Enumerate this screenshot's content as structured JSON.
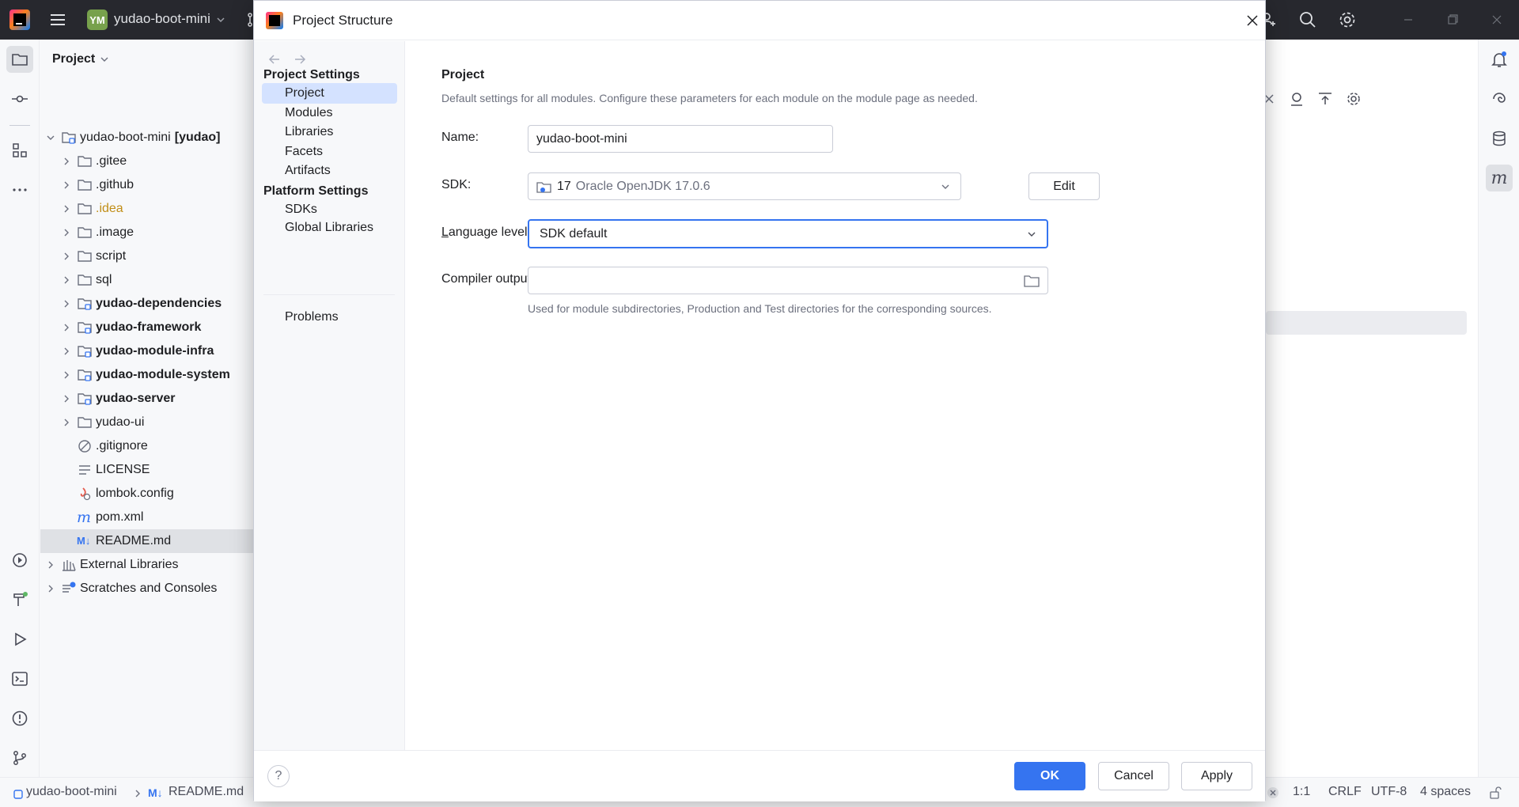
{
  "titlebar": {
    "project_badge": "YM",
    "project_name": "yudao-boot-mini"
  },
  "project_panel": {
    "header": "Project",
    "tree": [
      {
        "label": "yudao-boot-mini",
        "suffix": "[yudao]",
        "level": 0,
        "expandable": true,
        "expanded": true,
        "icon": "module-folder-icon",
        "bold": false
      },
      {
        "label": ".gitee",
        "level": 1,
        "expandable": true,
        "icon": "folder-icon",
        "bold": false
      },
      {
        "label": ".github",
        "level": 1,
        "expandable": true,
        "icon": "folder-icon",
        "bold": false
      },
      {
        "label": ".idea",
        "level": 1,
        "expandable": true,
        "icon": "folder-icon",
        "bold": false,
        "color": "#c18e17"
      },
      {
        "label": ".image",
        "level": 1,
        "expandable": true,
        "icon": "folder-icon",
        "bold": false
      },
      {
        "label": "script",
        "level": 1,
        "expandable": true,
        "icon": "folder-icon",
        "bold": false
      },
      {
        "label": "sql",
        "level": 1,
        "expandable": true,
        "icon": "folder-icon",
        "bold": false
      },
      {
        "label": "yudao-dependencies",
        "level": 1,
        "expandable": true,
        "icon": "module-folder-icon",
        "bold": true
      },
      {
        "label": "yudao-framework",
        "level": 1,
        "expandable": true,
        "icon": "module-folder-icon",
        "bold": true
      },
      {
        "label": "yudao-module-infra",
        "level": 1,
        "expandable": true,
        "icon": "module-folder-icon",
        "bold": true
      },
      {
        "label": "yudao-module-system",
        "level": 1,
        "expandable": true,
        "icon": "module-folder-icon",
        "bold": true
      },
      {
        "label": "yudao-server",
        "level": 1,
        "expandable": true,
        "icon": "module-folder-icon",
        "bold": true
      },
      {
        "label": "yudao-ui",
        "level": 1,
        "expandable": true,
        "icon": "folder-icon",
        "bold": false
      },
      {
        "label": ".gitignore",
        "level": 1,
        "expandable": false,
        "icon": "ignore-file-icon",
        "bold": false
      },
      {
        "label": "LICENSE",
        "level": 1,
        "expandable": false,
        "icon": "text-file-icon",
        "bold": false
      },
      {
        "label": "lombok.config",
        "level": 1,
        "expandable": false,
        "icon": "config-file-icon",
        "bold": false
      },
      {
        "label": "pom.xml",
        "level": 1,
        "expandable": false,
        "icon": "maven-icon",
        "bold": false
      },
      {
        "label": "README.md",
        "level": 1,
        "expandable": false,
        "icon": "markdown-icon",
        "bold": false,
        "selected": true
      },
      {
        "label": "External Libraries",
        "level": 0,
        "expandable": true,
        "icon": "libraries-icon",
        "bold": false
      },
      {
        "label": "Scratches and Consoles",
        "level": 0,
        "expandable": true,
        "icon": "scratches-icon",
        "bold": false
      }
    ]
  },
  "dialog": {
    "title": "Project Structure",
    "nav": {
      "groups": [
        {
          "label": "Project Settings",
          "items": [
            "Project",
            "Modules",
            "Libraries",
            "Facets",
            "Artifacts"
          ]
        },
        {
          "label": "Platform Settings",
          "items": [
            "SDKs",
            "Global Libraries"
          ]
        }
      ],
      "extra": "Problems",
      "selected": "Project"
    },
    "content": {
      "section_title": "Project",
      "section_desc": "Default settings for all modules. Configure these parameters for each module on the module page as needed.",
      "name_label": "Name:",
      "name_value": "yudao-boot-mini",
      "sdk_label": "SDK:",
      "sdk_version": "17",
      "sdk_name": "Oracle OpenJDK 17.0.6",
      "edit_label": "Edit",
      "language_label_prefix": "",
      "language_label_mnemonic": "L",
      "language_label_rest": "anguage level:",
      "language_value": "SDK default",
      "compiler_label": "Compiler output:",
      "compiler_value": "",
      "compiler_hint": "Used for module subdirectories, Production and Test directories for the corresponding sources."
    },
    "footer": {
      "help": "?",
      "ok": "OK",
      "cancel": "Cancel",
      "apply": "Apply"
    }
  },
  "statusbar": {
    "breadcrumb_project": "yudao-boot-mini",
    "breadcrumb_file": "README.md",
    "position": "1:1",
    "line_separator": "CRLF",
    "encoding": "UTF-8",
    "indent": "4 spaces"
  },
  "colors": {
    "accent": "#3574f0",
    "selection": "#d4e2ff",
    "titlebar": "#27282e"
  }
}
